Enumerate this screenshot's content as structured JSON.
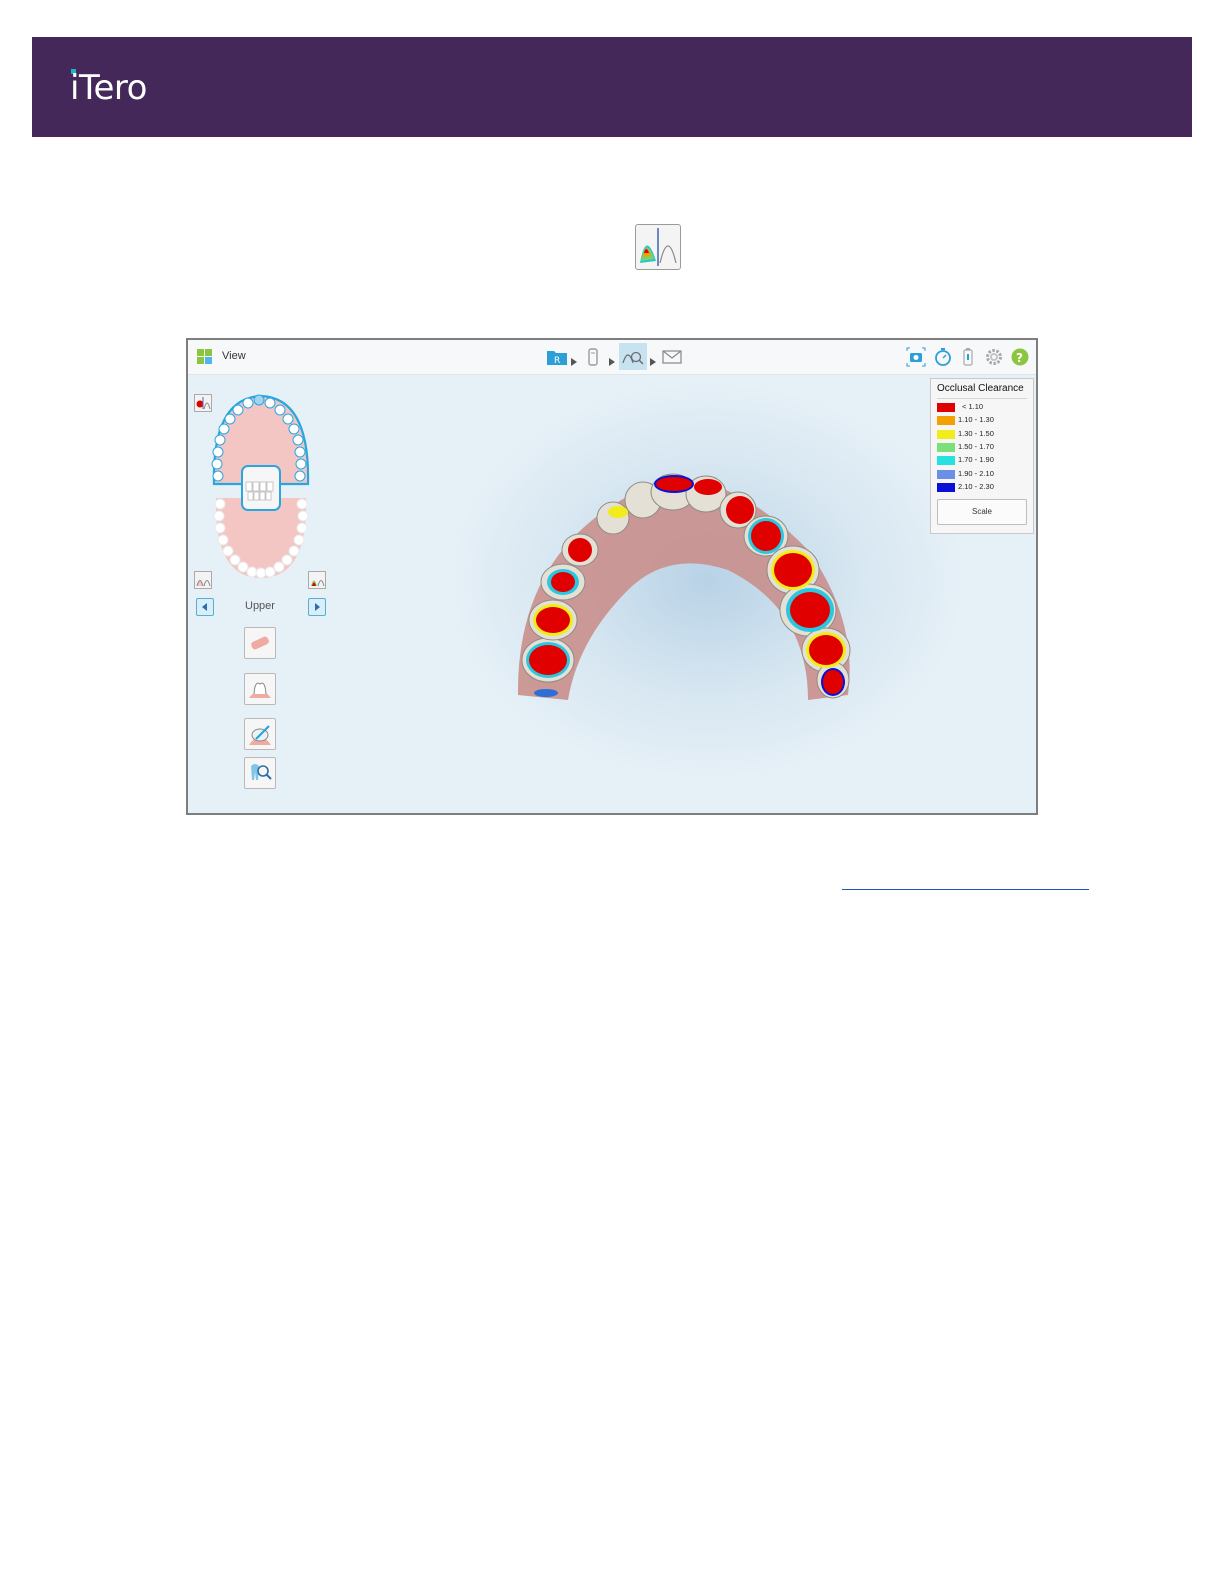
{
  "header": {
    "logo_text": "iTero",
    "background_color": "#432859",
    "logo_accent_color": "#19b6c9"
  },
  "occlusal_clearance_button": {
    "icon": "occlusal-clearance-icon"
  },
  "app": {
    "topbar": {
      "view_label": "View",
      "nav_steps": [
        {
          "icon": "rx-folder-icon",
          "active": false
        },
        {
          "icon": "scan-icon",
          "active": false
        },
        {
          "icon": "view-tools-icon",
          "active": true
        },
        {
          "icon": "send-envelope-icon",
          "active": false
        }
      ],
      "right_icons": [
        "snapshot-camera-icon",
        "timer-icon",
        "battery-icon",
        "settings-gear-icon",
        "help-icon"
      ]
    },
    "jaw_selector": {
      "label": "Upper",
      "highlight_color": "#2aa6de",
      "gum_color": "#f3c6c3"
    },
    "tool_buttons": [
      "eraser-tool-icon",
      "margin-line-icon",
      "trim-tool-icon",
      "review-tool-icon"
    ],
    "legend": {
      "title": "Occlusal Clearance",
      "items": [
        {
          "range": "< 1.10",
          "color": "#e00000"
        },
        {
          "range": "1.10 - 1.30",
          "color": "#f2a100"
        },
        {
          "range": "1.30 - 1.50",
          "color": "#f2ec1a"
        },
        {
          "range": "1.50 - 1.70",
          "color": "#7be07b"
        },
        {
          "range": "1.70 - 1.90",
          "color": "#27e0e0"
        },
        {
          "range": "1.90 - 2.10",
          "color": "#6b8ee6"
        },
        {
          "range": "2.10 - 2.30",
          "color": "#0a10d6"
        }
      ],
      "scale_button_label": "Scale"
    }
  }
}
